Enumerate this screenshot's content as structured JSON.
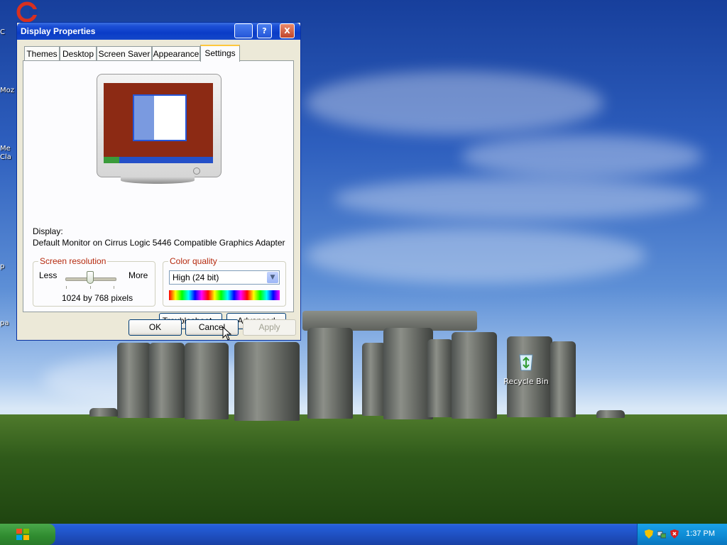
{
  "window": {
    "title": "Display Properties",
    "title_buttons": [
      "?",
      "X"
    ]
  },
  "tabs": [
    {
      "label": "Themes",
      "active": false
    },
    {
      "label": "Desktop",
      "active": false
    },
    {
      "label": "Screen Saver",
      "active": false
    },
    {
      "label": "Appearance",
      "active": false
    },
    {
      "label": "Settings",
      "active": true
    }
  ],
  "display": {
    "label": "Display:",
    "device": "Default Monitor on Cirrus Logic 5446 Compatible Graphics Adapter"
  },
  "resolution": {
    "title": "Screen resolution",
    "less": "Less",
    "more": "More",
    "value": "1024 by 768 pixels",
    "slider_level": 0.5
  },
  "color_quality": {
    "title": "Color quality",
    "selected": "High (24 bit)"
  },
  "buttons": {
    "troubleshoot": "Troubleshoot...",
    "advanced": "Advanced",
    "ok": "OK",
    "cancel": "Cancel",
    "apply": "Apply"
  },
  "desktop": {
    "recycle_bin": "Recycle Bin",
    "edge_labels": [
      "C",
      "Moz",
      "Me",
      "Cla",
      "p",
      "pa"
    ]
  },
  "taskbar": {
    "clock": "1:37 PM"
  },
  "colors": {
    "titlebar": "#0a3cc7",
    "group_title": "#b52a0e",
    "start_button": "#2f8b2f"
  }
}
